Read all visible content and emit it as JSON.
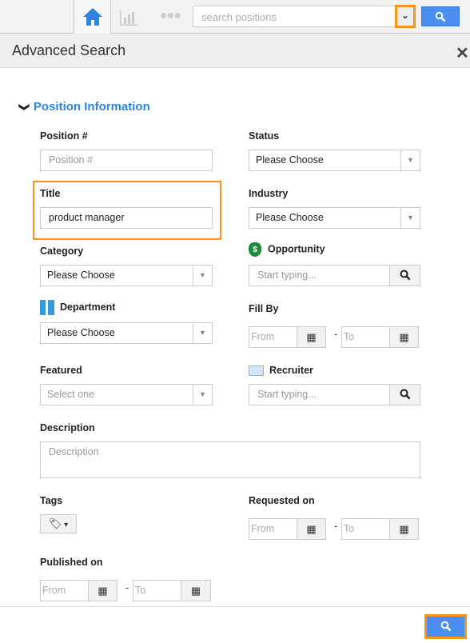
{
  "topbar": {
    "search_placeholder": "search positions",
    "icons": [
      "home-icon",
      "chart-icon",
      "more-icon"
    ]
  },
  "header": {
    "title": "Advanced Search",
    "close": "✕"
  },
  "section": {
    "title": "Position Information"
  },
  "fields": {
    "position_no": {
      "label": "Position #",
      "placeholder": "Position #"
    },
    "status": {
      "label": "Status",
      "value": "Please Choose"
    },
    "title": {
      "label": "Title",
      "value": "product manager"
    },
    "industry": {
      "label": "Industry",
      "value": "Please Choose"
    },
    "category": {
      "label": "Category",
      "value": "Please Choose"
    },
    "opportunity": {
      "label": "Opportunity",
      "placeholder": "Start typing..."
    },
    "department": {
      "label": "Department",
      "value": "Please Choose"
    },
    "fill_by": {
      "label": "Fill By",
      "from": "From",
      "to": "To"
    },
    "featured": {
      "label": "Featured",
      "value": "Select one"
    },
    "recruiter": {
      "label": "Recruiter",
      "placeholder": "Start typing..."
    },
    "description": {
      "label": "Description",
      "placeholder": "Description"
    },
    "tags": {
      "label": "Tags"
    },
    "requested_on": {
      "label": "Requested on",
      "from": "From",
      "to": "To"
    },
    "published_on": {
      "label": "Published on",
      "from": "From",
      "to": "To"
    }
  },
  "colors": {
    "accent": "#2e86de",
    "highlight": "#f7941d",
    "button": "#4a8ef0"
  }
}
